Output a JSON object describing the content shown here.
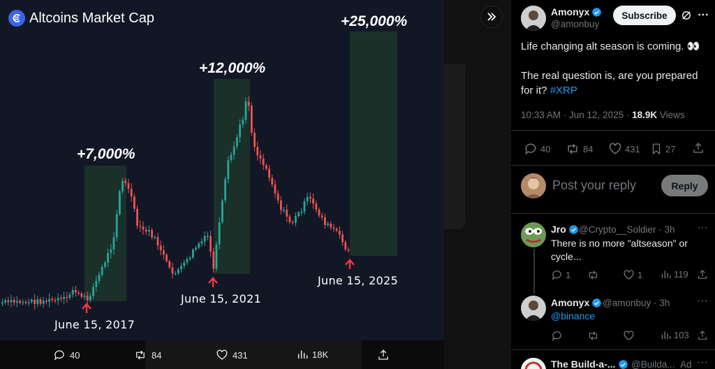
{
  "chart_image": {
    "title": "Altcoins Market Cap",
    "annotations": [
      {
        "pct": "+7,000%",
        "date": "June 15, 2017"
      },
      {
        "pct": "+12,000%",
        "date": "June 15, 2021"
      },
      {
        "pct": "+25,000%",
        "date": "June 15, 2025"
      }
    ]
  },
  "chart_data": {
    "type": "candlestick",
    "title": "Altcoins Market Cap",
    "annotations": [
      {
        "label": "+7,000%",
        "date": "June 15, 2017"
      },
      {
        "label": "+12,000%",
        "date": "June 15, 2021"
      },
      {
        "label": "+25,000%",
        "date": "June 15, 2025"
      }
    ]
  },
  "media_actions": {
    "replies": "40",
    "reposts": "84",
    "likes": "431",
    "views": "18K"
  },
  "tweet": {
    "author_name": "Amonyx",
    "author_handle": "@amonbuy",
    "subscribe_label": "Subscribe",
    "text_line1": "Life changing alt season is coming. 👀",
    "text_line2": "The real question is, are you prepared for it?",
    "hashtag": "#XRP",
    "time": "10:33 AM · Jun 12, 2025 ·",
    "views_count": "18.9K",
    "views_label": "Views",
    "replies": "40",
    "reposts": "84",
    "likes": "431",
    "bookmarks": "27"
  },
  "composer": {
    "placeholder": "Post your reply",
    "reply_label": "Reply"
  },
  "replies": [
    {
      "name": "Jro",
      "handle": "@Crypto__Soldier · 3h",
      "text": "There is no more \"altseason\" or cycle...",
      "replies": "1",
      "likes": "1",
      "views": "119"
    },
    {
      "name": "Amonyx",
      "handle": "@amonbuy · 3h",
      "text": "@binance",
      "views": "103"
    },
    {
      "name": "The Build-a-...",
      "handle": "@Builda...",
      "ad_label": "Ad"
    }
  ],
  "colors": {
    "accent": "#1d9bf0",
    "chart_bg": "#121726",
    "candle_up": "#26a69a",
    "candle_down": "#ef5350",
    "arrow": "#f23645",
    "zone": "#1f3a2b"
  }
}
